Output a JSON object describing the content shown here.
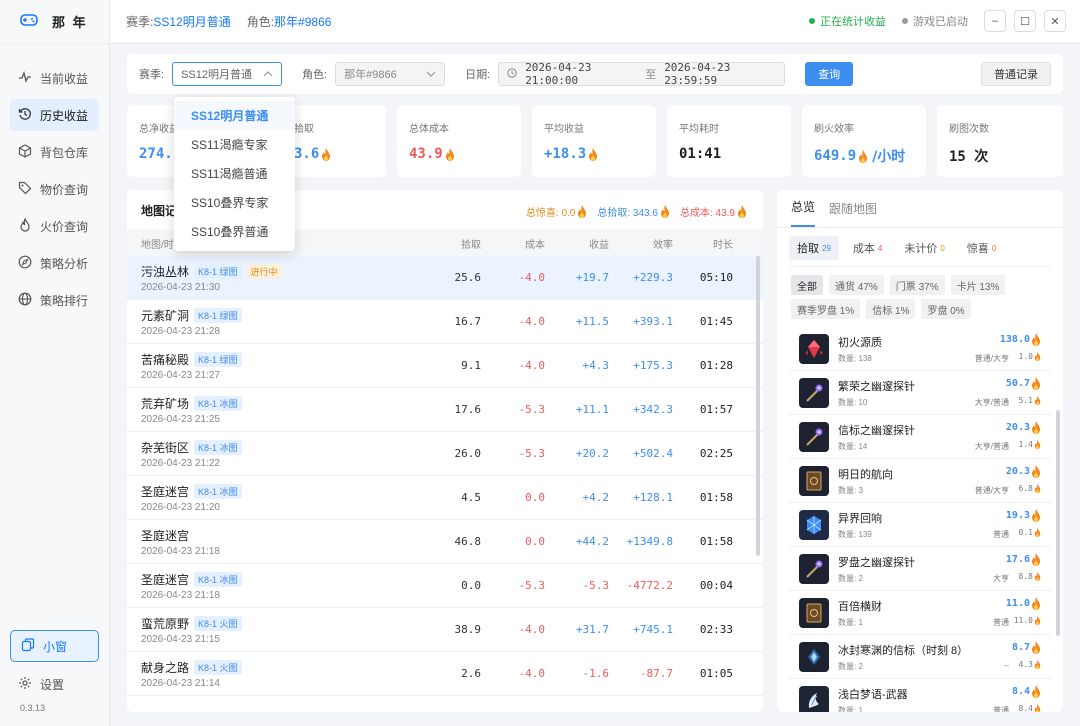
{
  "app": {
    "name": "那 年",
    "version": "0.3.13"
  },
  "header": {
    "season_label": "赛季:",
    "season_value": "SS12明月普通",
    "role_label": "角色:",
    "role_value": "那年#9866",
    "status_stats": "正在统计收益",
    "status_game": "游戏已启动",
    "status_colors": {
      "stats": "#22b14c",
      "game": "#999999"
    }
  },
  "sidebar": {
    "items": [
      {
        "label": "当前收益",
        "icon": "pulse-icon"
      },
      {
        "label": "历史收益",
        "icon": "history-icon"
      },
      {
        "label": "背包仓库",
        "icon": "box-icon"
      },
      {
        "label": "物价查询",
        "icon": "tag-icon"
      },
      {
        "label": "火价查询",
        "icon": "fire-icon"
      },
      {
        "label": "策略分析",
        "icon": "compass-icon"
      },
      {
        "label": "策略排行",
        "icon": "globe-icon"
      }
    ],
    "mini": "小窗",
    "settings": "设置"
  },
  "filter": {
    "season_label": "赛季:",
    "season_value": "SS12明月普通",
    "role_label": "角色:",
    "role_value": "那年#9866",
    "date_label": "日期:",
    "date_from": "2026-04-23 21:00:00",
    "date_sep": "至",
    "date_to": "2026-04-23 23:59:59",
    "query": "查询",
    "normal_record": "普通记录",
    "season_options": [
      "SS12明月普通",
      "SS11渴瘾专家",
      "SS11渴瘾普通",
      "SS10叠界专家",
      "SS10叠界普通"
    ]
  },
  "stats": [
    {
      "label": "总净收益",
      "value": "274.",
      "color": "blue",
      "unit": ""
    },
    {
      "label": "拾取",
      "value": "3.6",
      "color": "blue",
      "unit": ""
    },
    {
      "label": "总体成本",
      "value": "43.9",
      "color": "red",
      "unit": ""
    },
    {
      "label": "平均收益",
      "value": "+18.3",
      "color": "blue",
      "unit": ""
    },
    {
      "label": "平均耗时",
      "value": "01:41",
      "color": "dark",
      "unit": ""
    },
    {
      "label": "刷火效率",
      "value": "649.9",
      "color": "blue",
      "unit": "/小时"
    },
    {
      "label": "刷图次数",
      "value": "15 次",
      "color": "dark",
      "unit": ""
    }
  ],
  "records": {
    "title": "地图记",
    "sum_surprise": "总惊喜: 0.0",
    "sum_pickup": "总拾取: 343.6",
    "sum_cost": "总成本: 43.9",
    "headers": {
      "map": "地图/时",
      "pickup": "拾取",
      "cost": "成本",
      "income": "收益",
      "efficiency": "效率",
      "duration": "时长"
    },
    "rows": [
      {
        "name": "污浊丛林",
        "tag": "K8-1 绿图",
        "status": "进行中",
        "date": "2026-04-23 21:30",
        "pickup": "25.6",
        "cost": "-4.0",
        "income": "+19.7",
        "eff": "+229.3",
        "dur": "05:10",
        "active": true
      },
      {
        "name": "元素矿洞",
        "tag": "K8-1 绿图",
        "status": "",
        "date": "2026-04-23 21:28",
        "pickup": "16.7",
        "cost": "-4.0",
        "income": "+11.5",
        "eff": "+393.1",
        "dur": "01:45"
      },
      {
        "name": "苦痛秘殿",
        "tag": "K8-1 绿图",
        "status": "",
        "date": "2026-04-23 21:27",
        "pickup": "9.1",
        "cost": "-4.0",
        "income": "+4.3",
        "eff": "+175.3",
        "dur": "01:28"
      },
      {
        "name": "荒弃矿场",
        "tag": "K8-1 冰图",
        "status": "",
        "date": "2026-04-23 21:25",
        "pickup": "17.6",
        "cost": "-5.3",
        "income": "+11.1",
        "eff": "+342.3",
        "dur": "01:57"
      },
      {
        "name": "杂芜街区",
        "tag": "K8-1 冰图",
        "status": "",
        "date": "2026-04-23 21:22",
        "pickup": "26.0",
        "cost": "-5.3",
        "income": "+20.2",
        "eff": "+502.4",
        "dur": "02:25"
      },
      {
        "name": "圣庭迷宫",
        "tag": "K8-1 冰图",
        "status": "",
        "date": "2026-04-23 21:20",
        "pickup": "4.5",
        "cost": "0.0",
        "income": "+4.2",
        "eff": "+128.1",
        "dur": "01:58"
      },
      {
        "name": "圣庭迷宫",
        "tag": "",
        "status": "",
        "date": "2026-04-23 21:18",
        "pickup": "46.8",
        "cost": "0.0",
        "income": "+44.2",
        "eff": "+1349.8",
        "dur": "01:58"
      },
      {
        "name": "圣庭迷宫",
        "tag": "K8-1 冰图",
        "status": "",
        "date": "2026-04-23 21:18",
        "pickup": "0.0",
        "cost": "-5.3",
        "income": "-5.3",
        "eff": "-4772.2",
        "dur": "00:04"
      },
      {
        "name": "蛮荒原野",
        "tag": "K8-1 火图",
        "status": "",
        "date": "2026-04-23 21:15",
        "pickup": "38.9",
        "cost": "-4.0",
        "income": "+31.7",
        "eff": "+745.1",
        "dur": "02:33"
      },
      {
        "name": "献身之路",
        "tag": "K8-1 火图",
        "status": "",
        "date": "2026-04-23 21:14",
        "pickup": "2.6",
        "cost": "-4.0",
        "income": "-1.6",
        "eff": "-87.7",
        "dur": "01:05"
      }
    ]
  },
  "right": {
    "tabs": [
      "总览",
      "跟随地图"
    ],
    "subtabs": [
      {
        "label": "拾取",
        "count": "29"
      },
      {
        "label": "成本",
        "count": "4"
      },
      {
        "label": "未计价",
        "count": "0"
      },
      {
        "label": "惊喜",
        "count": "0"
      }
    ],
    "filters": [
      "全部",
      "通货 47%",
      "门票 37%",
      "卡片 13%",
      "赛季罗盘 1%",
      "信标 1%",
      "罗盘 0%"
    ],
    "items": [
      {
        "name": "初火源质",
        "qty": "数量: 138",
        "type": "普通/大亨",
        "val": "138.0",
        "unit": "1.0",
        "icon": "crystal-icon"
      },
      {
        "name": "繁荣之幽邃探针",
        "qty": "数量: 10",
        "type": "大亨/普通",
        "val": "50.7",
        "unit": "5.1",
        "icon": "probe-icon"
      },
      {
        "name": "信标之幽邃探针",
        "qty": "数量: 14",
        "type": "大亨/普通",
        "val": "20.3",
        "unit": "1.4",
        "icon": "probe-icon"
      },
      {
        "name": "明日的航向",
        "qty": "数量: 3",
        "type": "普通/大亨",
        "val": "20.3",
        "unit": "6.8",
        "icon": "card-icon"
      },
      {
        "name": "异界回响",
        "qty": "数量: 139",
        "type": "普通",
        "val": "19.3",
        "unit": "0.1",
        "icon": "echo-icon"
      },
      {
        "name": "罗盘之幽邃探针",
        "qty": "数量: 2",
        "type": "大亨",
        "val": "17.6",
        "unit": "8.8",
        "icon": "probe-icon"
      },
      {
        "name": "百倍横财",
        "qty": "数量: 1",
        "type": "普通",
        "val": "11.0",
        "unit": "11.0",
        "icon": "card-icon"
      },
      {
        "name": "冰封寒渊的信标（时刻 8）",
        "qty": "数量: 2",
        "type": "--",
        "val": "8.7",
        "unit": "4.3",
        "icon": "beacon-icon"
      },
      {
        "name": "浅白梦语-武器",
        "qty": "数量: 1",
        "type": "普通",
        "val": "8.4",
        "unit": "8.4",
        "icon": "dream-icon"
      }
    ]
  }
}
